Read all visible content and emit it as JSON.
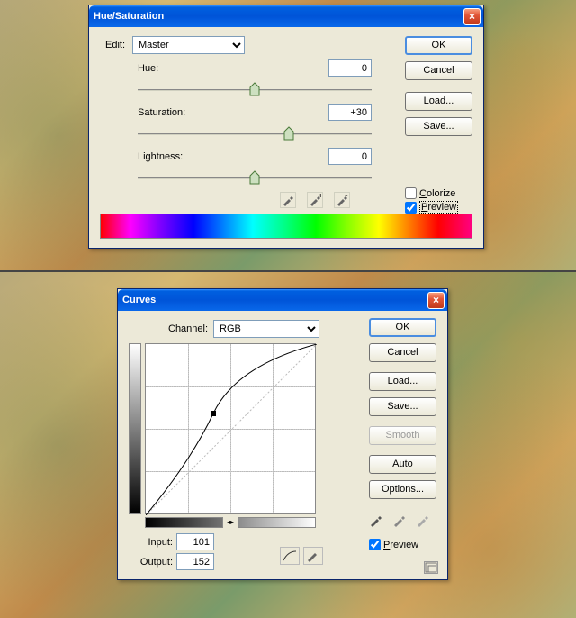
{
  "hue_sat": {
    "title": "Hue/Saturation",
    "edit_label": "Edit:",
    "edit_value": "Master",
    "hue_label": "Hue:",
    "hue_value": "0",
    "sat_label": "Saturation:",
    "sat_value": "+30",
    "light_label": "Lightness:",
    "light_value": "0",
    "ok": "OK",
    "cancel": "Cancel",
    "load": "Load...",
    "save": "Save...",
    "colorize": "Colorize",
    "preview": "Preview",
    "colorize_checked": false,
    "preview_checked": true
  },
  "curves": {
    "title": "Curves",
    "channel_label": "Channel:",
    "channel_value": "RGB",
    "input_label": "Input:",
    "input_value": "101",
    "output_label": "Output:",
    "output_value": "152",
    "ok": "OK",
    "cancel": "Cancel",
    "load": "Load...",
    "save": "Save...",
    "smooth": "Smooth",
    "auto": "Auto",
    "options": "Options...",
    "preview": "Preview",
    "preview_checked": true
  },
  "chart_data": {
    "type": "line",
    "title": "Curves",
    "xlabel": "Input",
    "ylabel": "Output",
    "xlim": [
      0,
      255
    ],
    "ylim": [
      0,
      255
    ],
    "points": [
      {
        "input": 0,
        "output": 0
      },
      {
        "input": 101,
        "output": 152
      },
      {
        "input": 255,
        "output": 255
      }
    ],
    "baseline": [
      {
        "input": 0,
        "output": 0
      },
      {
        "input": 255,
        "output": 255
      }
    ]
  }
}
